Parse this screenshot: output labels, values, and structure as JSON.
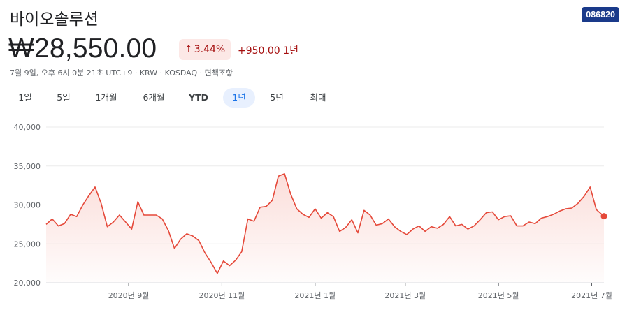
{
  "header": {
    "company": "바이오솔루션",
    "ticker": "086820",
    "price": "₩28,550.00",
    "pct_change": "3.44%",
    "abs_change": "+950.00 1년",
    "meta": "7월 9일, 오후 6시 0분 21초 UTC+9 · KRW · KOSDAQ · 면책조항"
  },
  "tabs": [
    {
      "label": "1일",
      "active": false
    },
    {
      "label": "5일",
      "active": false
    },
    {
      "label": "1개월",
      "active": false
    },
    {
      "label": "6개월",
      "active": false
    },
    {
      "label": "YTD",
      "active": false
    },
    {
      "label": "1년",
      "active": true
    },
    {
      "label": "5년",
      "active": false
    },
    {
      "label": "최대",
      "active": false
    }
  ],
  "colors": {
    "line": "#e5493a",
    "fill": "#fbdcd8",
    "grid": "#ebebeb",
    "badge_bg": "#fce8e6",
    "negative_text": "#a50e0e",
    "ticker_bg": "#1a3a8a"
  },
  "chart_data": {
    "type": "area",
    "title": "",
    "xlabel": "",
    "ylabel": "",
    "ylim": [
      20000,
      40000
    ],
    "yticks": [
      20000,
      25000,
      30000,
      35000,
      40000
    ],
    "ytick_labels": [
      "20,000",
      "25,000",
      "30,000",
      "35,000",
      "40,000"
    ],
    "xticks": [
      "2020-09-01",
      "2020-11-01",
      "2021-01-01",
      "2021-03-01",
      "2021-05-01",
      "2021-07-01"
    ],
    "xtick_labels": [
      "2020년 9월",
      "2020년 11월",
      "2021년 1월",
      "2021년 3월",
      "2021년 5월",
      "2021년 7월"
    ],
    "xlim": [
      "2020-07-09",
      "2021-07-09"
    ],
    "grid": true,
    "series": [
      {
        "x": [
          "2020-07-09",
          "2020-07-13",
          "2020-07-17",
          "2020-07-21",
          "2020-07-25",
          "2020-07-29",
          "2020-08-02",
          "2020-08-06",
          "2020-08-10",
          "2020-08-14",
          "2020-08-18",
          "2020-08-22",
          "2020-08-26",
          "2020-08-30",
          "2020-09-03",
          "2020-09-07",
          "2020-09-11",
          "2020-09-15",
          "2020-09-19",
          "2020-09-23",
          "2020-09-27",
          "2020-10-01",
          "2020-10-05",
          "2020-10-09",
          "2020-10-13",
          "2020-10-17",
          "2020-10-21",
          "2020-10-25",
          "2020-10-29",
          "2020-11-02",
          "2020-11-06",
          "2020-11-10",
          "2020-11-14",
          "2020-11-18",
          "2020-11-22",
          "2020-11-26",
          "2020-11-30",
          "2020-12-04",
          "2020-12-08",
          "2020-12-12",
          "2020-12-16",
          "2020-12-20",
          "2020-12-24",
          "2020-12-28",
          "2021-01-01",
          "2021-01-05",
          "2021-01-09",
          "2021-01-13",
          "2021-01-17",
          "2021-01-21",
          "2021-01-25",
          "2021-01-29",
          "2021-02-02",
          "2021-02-06",
          "2021-02-10",
          "2021-02-14",
          "2021-02-18",
          "2021-02-22",
          "2021-02-26",
          "2021-03-02",
          "2021-03-06",
          "2021-03-10",
          "2021-03-14",
          "2021-03-18",
          "2021-03-22",
          "2021-03-26",
          "2021-03-30",
          "2021-04-03",
          "2021-04-07",
          "2021-04-11",
          "2021-04-15",
          "2021-04-19",
          "2021-04-23",
          "2021-04-27",
          "2021-05-01",
          "2021-05-05",
          "2021-05-09",
          "2021-05-13",
          "2021-05-17",
          "2021-05-21",
          "2021-05-25",
          "2021-05-29",
          "2021-06-02",
          "2021-06-06",
          "2021-06-10",
          "2021-06-14",
          "2021-06-18",
          "2021-06-22",
          "2021-06-26",
          "2021-06-30",
          "2021-07-04",
          "2021-07-09"
        ],
        "values": [
          27500,
          28200,
          27300,
          27600,
          28800,
          28500,
          30000,
          31200,
          32300,
          30200,
          27200,
          27800,
          28700,
          27800,
          26900,
          30400,
          28700,
          28700,
          28700,
          28200,
          26700,
          24400,
          25600,
          26300,
          26000,
          25400,
          23800,
          22600,
          21200,
          22800,
          22200,
          22900,
          24000,
          28200,
          27900,
          29700,
          29800,
          30600,
          33700,
          34000,
          31400,
          29500,
          28800,
          28400,
          29500,
          28300,
          29000,
          28500,
          26600,
          27100,
          28100,
          26400,
          29300,
          28700,
          27400,
          27600,
          28200,
          27200,
          26600,
          26200,
          26900,
          27300,
          26600,
          27200,
          27000,
          27500,
          28500,
          27300,
          27500,
          26900,
          27300,
          28100,
          29000,
          29100,
          28100,
          28500,
          28600,
          27300,
          27300,
          27800,
          27600,
          28300,
          28500,
          28800,
          29200,
          29500,
          29600,
          30200,
          31100,
          32300,
          29400,
          28550
        ]
      }
    ]
  }
}
